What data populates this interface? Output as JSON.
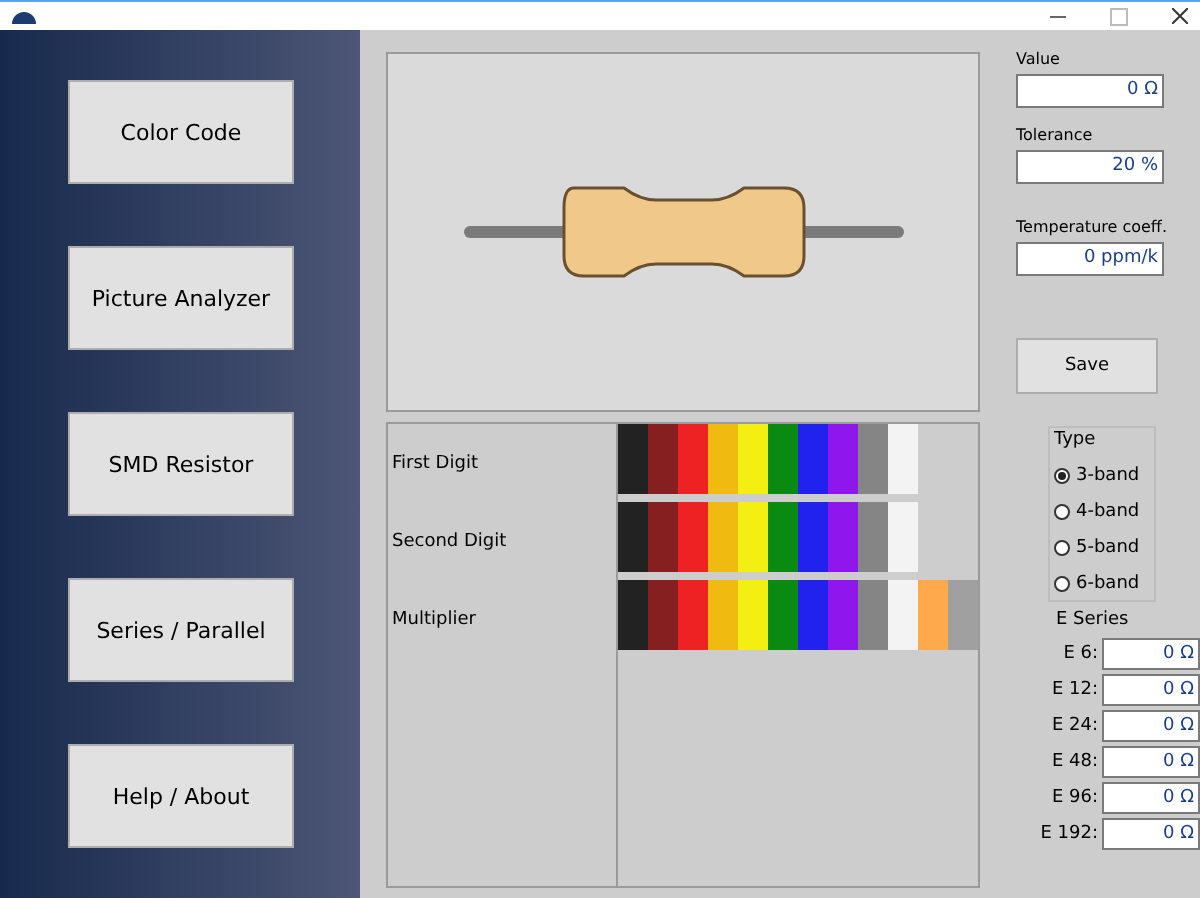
{
  "nav": [
    {
      "label": "Color Code"
    },
    {
      "label": "Picture Analyzer"
    },
    {
      "label": "SMD Resistor"
    },
    {
      "label": "Series / Parallel"
    },
    {
      "label": "Help / About"
    }
  ],
  "bands": [
    {
      "label": "First Digit",
      "swatches": [
        {
          "color": "#222222"
        },
        {
          "color": "#862020"
        },
        {
          "color": "#ee2222"
        },
        {
          "color": "#efbb10"
        },
        {
          "color": "#f3ef10"
        },
        {
          "color": "#0b8a12"
        },
        {
          "color": "#2222ee"
        },
        {
          "color": "#9016ee"
        },
        {
          "color": "#858585"
        },
        {
          "color": "#f3f3f3"
        }
      ]
    },
    {
      "label": "Second Digit",
      "swatches": [
        {
          "color": "#222222"
        },
        {
          "color": "#862020"
        },
        {
          "color": "#ee2222"
        },
        {
          "color": "#efbb10"
        },
        {
          "color": "#f3ef10"
        },
        {
          "color": "#0b8a12"
        },
        {
          "color": "#2222ee"
        },
        {
          "color": "#9016ee"
        },
        {
          "color": "#858585"
        },
        {
          "color": "#f3f3f3"
        }
      ]
    },
    {
      "label": "Multiplier",
      "swatches": [
        {
          "color": "#222222"
        },
        {
          "color": "#862020"
        },
        {
          "color": "#ee2222"
        },
        {
          "color": "#efbb10"
        },
        {
          "color": "#f3ef10"
        },
        {
          "color": "#0b8a12"
        },
        {
          "color": "#2222ee"
        },
        {
          "color": "#9016ee"
        },
        {
          "color": "#858585"
        },
        {
          "color": "#f3f3f3"
        },
        {
          "color": "#ffa94d"
        },
        {
          "color": "#a0a0a0"
        }
      ]
    }
  ],
  "fields": [
    {
      "label": "Value",
      "value": "0 Ω"
    },
    {
      "label": "Tolerance",
      "value": "20 %"
    },
    {
      "label": "Temperature coeff.",
      "value": "0 ppm/k"
    }
  ],
  "save": "Save",
  "type_group": {
    "title": "Type",
    "options": [
      {
        "label": "3-band",
        "selected": true
      },
      {
        "label": "4-band",
        "selected": false
      },
      {
        "label": "5-band",
        "selected": false
      },
      {
        "label": "6-band",
        "selected": false
      }
    ]
  },
  "e_series": {
    "title": "E Series",
    "rows": [
      {
        "label": "E 6:",
        "value": "0 Ω"
      },
      {
        "label": "E 12:",
        "value": "0 Ω"
      },
      {
        "label": "E 24:",
        "value": "0 Ω"
      },
      {
        "label": "E 48:",
        "value": "0 Ω"
      },
      {
        "label": "E 96:",
        "value": "0 Ω"
      },
      {
        "label": "E 192:",
        "value": "0 Ω"
      }
    ]
  }
}
